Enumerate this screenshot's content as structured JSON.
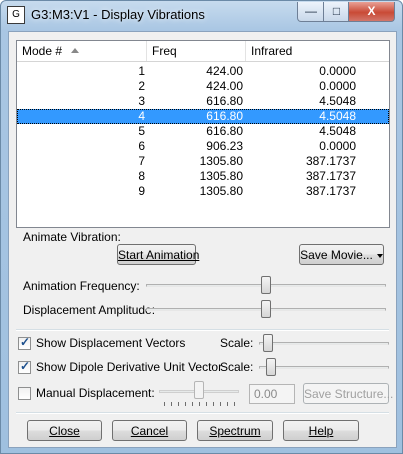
{
  "window": {
    "title": "G3:M3:V1 - Display Vibrations",
    "icon_glyph": "G",
    "controls": {
      "minimize": "—",
      "maximize": "□",
      "close": "X"
    }
  },
  "table": {
    "columns": [
      "Mode #",
      "Freq",
      "Infrared"
    ],
    "sort_column": "Mode #",
    "sort_direction": "ascending",
    "selected_mode": "4",
    "rows": [
      {
        "mode": "1",
        "freq": "424.00",
        "ir": "0.0000"
      },
      {
        "mode": "2",
        "freq": "424.00",
        "ir": "0.0000"
      },
      {
        "mode": "3",
        "freq": "616.80",
        "ir": "4.5048"
      },
      {
        "mode": "4",
        "freq": "616.80",
        "ir": "4.5048"
      },
      {
        "mode": "5",
        "freq": "616.80",
        "ir": "4.5048"
      },
      {
        "mode": "6",
        "freq": "906.23",
        "ir": "0.0000"
      },
      {
        "mode": "7",
        "freq": "1305.80",
        "ir": "387.1737"
      },
      {
        "mode": "8",
        "freq": "1305.80",
        "ir": "387.1737"
      },
      {
        "mode": "9",
        "freq": "1305.80",
        "ir": "387.1737"
      }
    ]
  },
  "animate": {
    "group_label": "Animate Vibration:",
    "start_button": "Start Animation",
    "save_movie_button": "Save Movie...",
    "frequency_label": "Animation Frequency:",
    "frequency_level": 0.5,
    "amplitude_label": "Displacement Amplitude:",
    "amplitude_level": 0.5
  },
  "options": {
    "show_vectors_label": "Show Displacement Vectors",
    "show_vectors_checked": true,
    "show_dipole_label": "Show Dipole Derivative Unit Vector",
    "show_dipole_checked": true,
    "scale_label": "Scale:",
    "vectors_scale_level": 0.03,
    "dipole_scale_level": 0.06,
    "manual_label": "Manual Displacement:",
    "manual_checked": false,
    "manual_level": 0.5,
    "manual_value": "0.00",
    "save_structure_button": "Save Structure..."
  },
  "footer": {
    "close": "Close",
    "cancel": "Cancel",
    "spectrum": "Spectrum",
    "help": "Help"
  },
  "colors": {
    "selection": "#3399ff",
    "title_bar": "#a9c6e3",
    "close_button": "#c94a36"
  }
}
